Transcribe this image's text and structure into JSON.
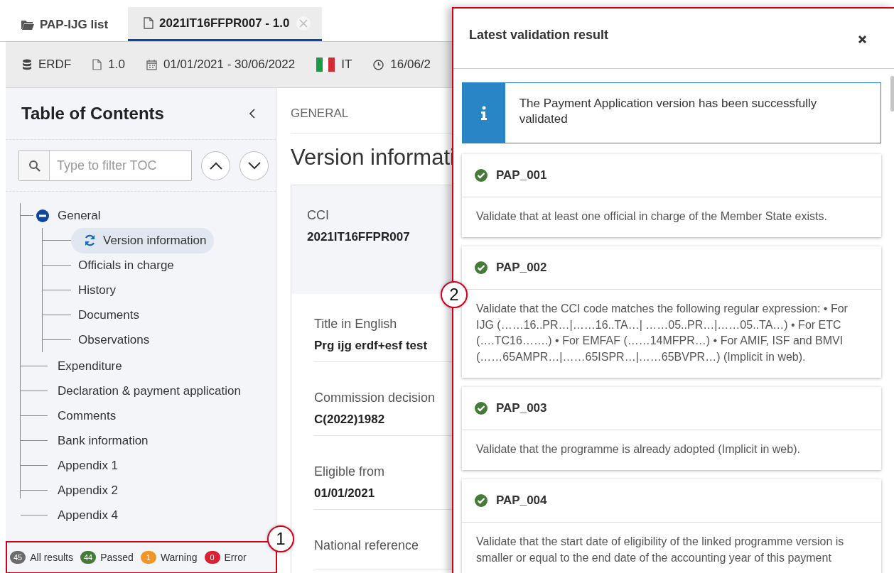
{
  "tabs": [
    {
      "kind": "folder",
      "label": "PAP-IJG list",
      "selected": false,
      "closable": false
    },
    {
      "kind": "file",
      "label": "2021IT16FFPR007 - 1.0",
      "selected": true,
      "closable": true
    }
  ],
  "info_bar": [
    {
      "kind": "database",
      "text": "ERDF"
    },
    {
      "kind": "file",
      "text": "1.0"
    },
    {
      "kind": "calendar",
      "text": "01/01/2021 - 30/06/2022"
    },
    {
      "kind": "flag",
      "text": "IT"
    },
    {
      "kind": "clock",
      "text": "16/06/2"
    }
  ],
  "toc": {
    "title": "Table of Contents",
    "filter": {
      "placeholder": "Type to filter TOC"
    },
    "items": [
      {
        "label": "General",
        "selected": false,
        "expanded": true,
        "children": [
          {
            "label": "Version information",
            "selected": true
          },
          {
            "label": "Officials in charge",
            "selected": false
          },
          {
            "label": "History",
            "selected": false
          },
          {
            "label": "Documents",
            "selected": false
          },
          {
            "label": "Observations",
            "selected": false
          }
        ]
      },
      {
        "label": "Expenditure",
        "selected": false
      },
      {
        "label": "Declaration & payment application",
        "selected": false
      },
      {
        "label": "Comments",
        "selected": false
      },
      {
        "label": "Bank information",
        "selected": false
      },
      {
        "label": "Appendix 1",
        "selected": false
      },
      {
        "label": "Appendix 2",
        "selected": false
      },
      {
        "label": "Appendix 4",
        "selected": false
      }
    ]
  },
  "status_bar": [
    {
      "count": "45",
      "label": "All results",
      "color": "#6b6b6b"
    },
    {
      "count": "44",
      "label": "Passed",
      "color": "#467a39"
    },
    {
      "count": "1",
      "label": "Warning",
      "color": "#f29527"
    },
    {
      "count": "0",
      "label": "Error",
      "color": "#da2131"
    }
  ],
  "main": {
    "breadcrumb": "GENERAL",
    "heading": "Version informati",
    "fields": [
      {
        "kind": "summary",
        "label": "CCI",
        "value": "2021IT16FFPR007"
      },
      {
        "kind": "field",
        "label": "Title in English",
        "value": "Prg ijg erdf+esf test"
      },
      {
        "kind": "field",
        "label": "Commission decision",
        "value": "C(2022)1982"
      },
      {
        "kind": "field",
        "label": "Eligible from",
        "value": "01/01/2021"
      },
      {
        "kind": "field",
        "label": "National reference"
      }
    ]
  },
  "panel": {
    "title": "Latest validation result",
    "message": "The Payment Application version has been successfully validated",
    "results": [
      {
        "code": "PAP_001",
        "passed": true,
        "description": "Validate that at least one official in charge of the Member State exists."
      },
      {
        "code": "PAP_002",
        "passed": true,
        "description": "Validate that the CCI code matches the following regular expression: • For IJG (……16..PR…|……16..TA…| ……05..PR…|……05..TA…) • For ETC (….TC16…….) • For EMFAF (……14MFPR…) • For AMIF, ISF and BMVI (……65AMPR…|……65ISPR…|……65BVPR…) (Implicit in web)."
      },
      {
        "code": "PAP_003",
        "passed": true,
        "description": "Validate that the programme is already adopted (Implicit in web)."
      },
      {
        "code": "PAP_004",
        "passed": true,
        "description": "Validate that the start date of eligibility of the linked programme version is smaller or equal to the end date of the accounting year of this payment"
      }
    ]
  },
  "callouts": [
    "1",
    "2"
  ]
}
